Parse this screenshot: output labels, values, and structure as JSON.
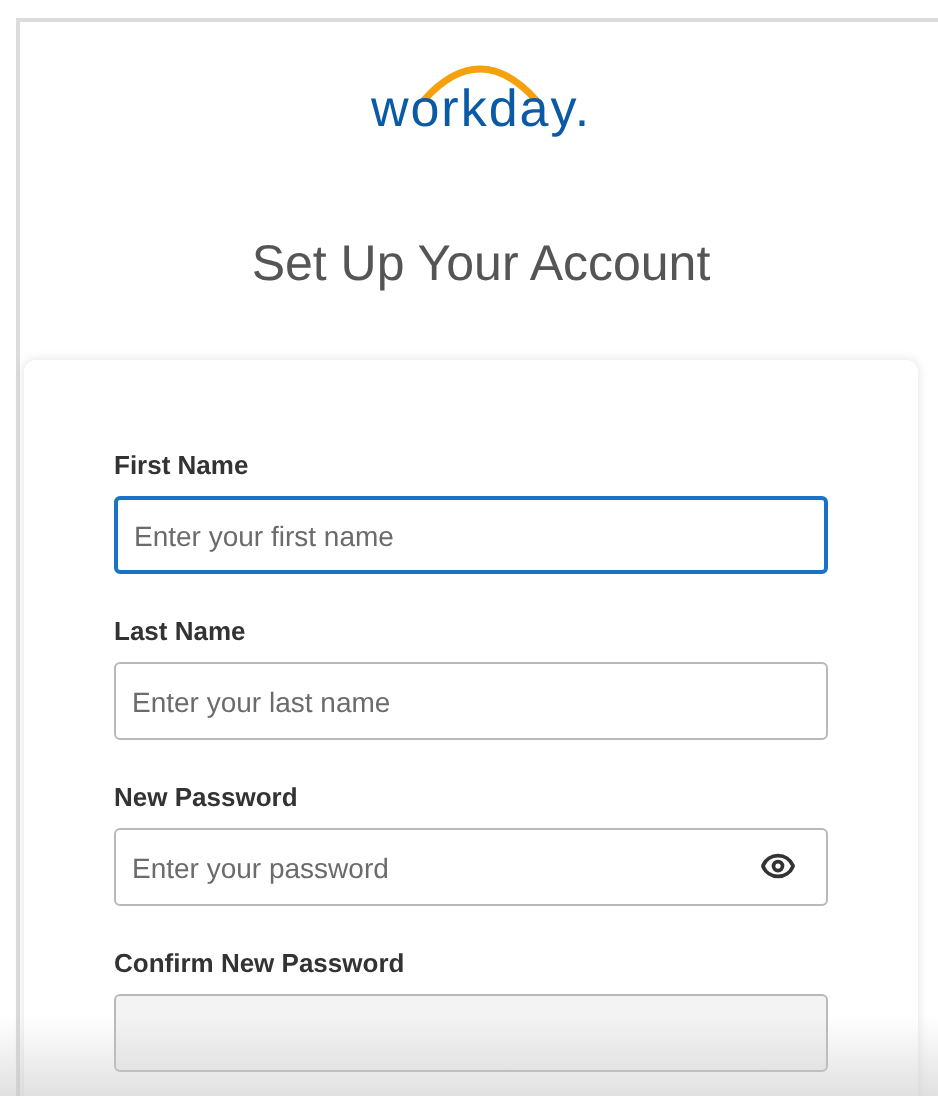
{
  "logo": {
    "text": "workday."
  },
  "title": "Set Up Your Account",
  "fields": [
    {
      "label": "First Name",
      "placeholder": "Enter your first name",
      "kind": "text",
      "focused": true
    },
    {
      "label": "Last Name",
      "placeholder": "Enter your last name",
      "kind": "text",
      "focused": false
    },
    {
      "label": "New Password",
      "placeholder": "Enter your password",
      "kind": "password",
      "focused": false
    },
    {
      "label": "Confirm New Password",
      "kind": "password_cut",
      "focused": false
    }
  ]
}
